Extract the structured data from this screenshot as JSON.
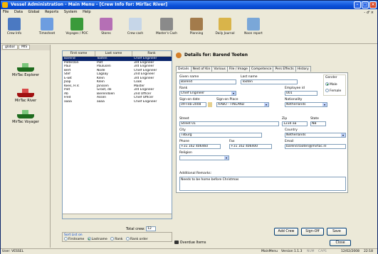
{
  "window": {
    "title": "Vessel Administration - Main Menu - [Crew Info for: MirTac River]"
  },
  "menu": [
    "File",
    "Data",
    "Global",
    "Reports",
    "System",
    "Help"
  ],
  "menu_right": "- ♂ ×",
  "toolbar": [
    {
      "label": "Crew Info",
      "color": "#4b79c2"
    },
    {
      "label": "Timesheet",
      "color": "#6d9de0"
    },
    {
      "label": "Voyages / POC",
      "color": "#3a9a3a"
    },
    {
      "label": "Stores",
      "color": "#b56fb5"
    },
    {
      "label": "Crew cash",
      "color": "#c6d6e8"
    },
    {
      "label": "Master's Cash",
      "color": "#8a8a8a"
    },
    {
      "label": "Planning",
      "color": "#a37b4b"
    },
    {
      "label": "Daily Journal",
      "color": "#d9b44a"
    },
    {
      "label": "Noon report",
      "color": "#7aa7d8"
    }
  ],
  "left_panel": {
    "tabs": [
      "global",
      "MIS"
    ],
    "vessels": [
      "MirTac Explorer",
      "MirTac River",
      "MirTac Voyager"
    ]
  },
  "crew_list": {
    "headers": [
      "First name",
      "Last name",
      "Rank"
    ],
    "rows": [
      [
        "Barend",
        "Tooten",
        "Chief Engineer"
      ],
      [
        "Pieterzon",
        "Piet",
        "3rd Engineer"
      ],
      [
        "Paul",
        "Paulusen",
        "3rd Engineer"
      ],
      [
        "Bert",
        "Node",
        "Chief Engineer"
      ],
      [
        "Stef",
        "Lagaay",
        "2nd Engineer"
      ],
      [
        "E-wit",
        "Klein",
        "3rd Engineer"
      ],
      [
        "Jaap",
        "Klein",
        "Cook"
      ],
      [
        "Kees, H.V.",
        "Janssen",
        "Master"
      ],
      [
        "Piet",
        "Groot, de",
        "3rd Engineer"
      ],
      [
        "Ab",
        "Bierendoen",
        "2nd Officer"
      ],
      [
        "Fred",
        "Assen",
        "Chief Officer"
      ],
      [
        "aaaa",
        "aaaa",
        "Chief Engineer"
      ]
    ],
    "total_label": "Total crew:",
    "total_value": "12",
    "sort_label": "Sort List on",
    "sort_options": [
      "Firstname",
      "Lastname",
      "Rank",
      "Rank order"
    ],
    "sort_selected": "Lastname"
  },
  "details": {
    "title": "Details for: Barend Tooten",
    "tabs": [
      "Details",
      "Next of Kin",
      "Various",
      "File / Image",
      "Competence",
      "Pers Effects",
      "History"
    ],
    "active_tab": "Details",
    "fields": {
      "given_name_label": "Given name",
      "given_name": "Barend",
      "last_name_label": "Last name",
      "last_name": "Tooten",
      "gender_label": "Gender",
      "gender_male": "Male",
      "gender_female": "Female",
      "rank_label": "Rank",
      "rank": "Chief Engineer",
      "employee_id_label": "Employee id",
      "employee_id": "001",
      "sign_on_date_label": "Sign-on date",
      "sign_on_date": "09-Feb-2008",
      "sign_on_place_label": "Sign-on Place",
      "sign_on_place": "AABO - FINLAND",
      "nationality_label": "Nationality",
      "nationality": "Netherlands",
      "street_label": "Street",
      "street": "Street 01",
      "zip_label": "Zip",
      "zip": "1234 aa",
      "state_label": "State",
      "state": "NB",
      "city_label": "City",
      "city": "Tilburg",
      "country_label": "Country",
      "country": "Netherlands",
      "phone_label": "Phone",
      "phone": "+31 162 406460",
      "fax_label": "Fax",
      "fax": "+31 162 406400",
      "email_label": "Email",
      "email": "barend.tooten@mirtac.nl",
      "religion_label": "Religion",
      "religion": "",
      "remarks_label": "Additional Remarks:",
      "remarks": "Needs to be home before Christmas"
    },
    "buttons": {
      "add_crew": "Add Crew",
      "sign_off": "Sign-Off",
      "save": "Save"
    }
  },
  "overdue": "Overdue Items",
  "close": "Close",
  "status": {
    "user": "User: VESSEL",
    "module": "MainMenu",
    "version": "Version 1.1.3",
    "num": "NUM",
    "caps": "CAPS",
    "date": "12/02/2008",
    "time": "22:18"
  }
}
